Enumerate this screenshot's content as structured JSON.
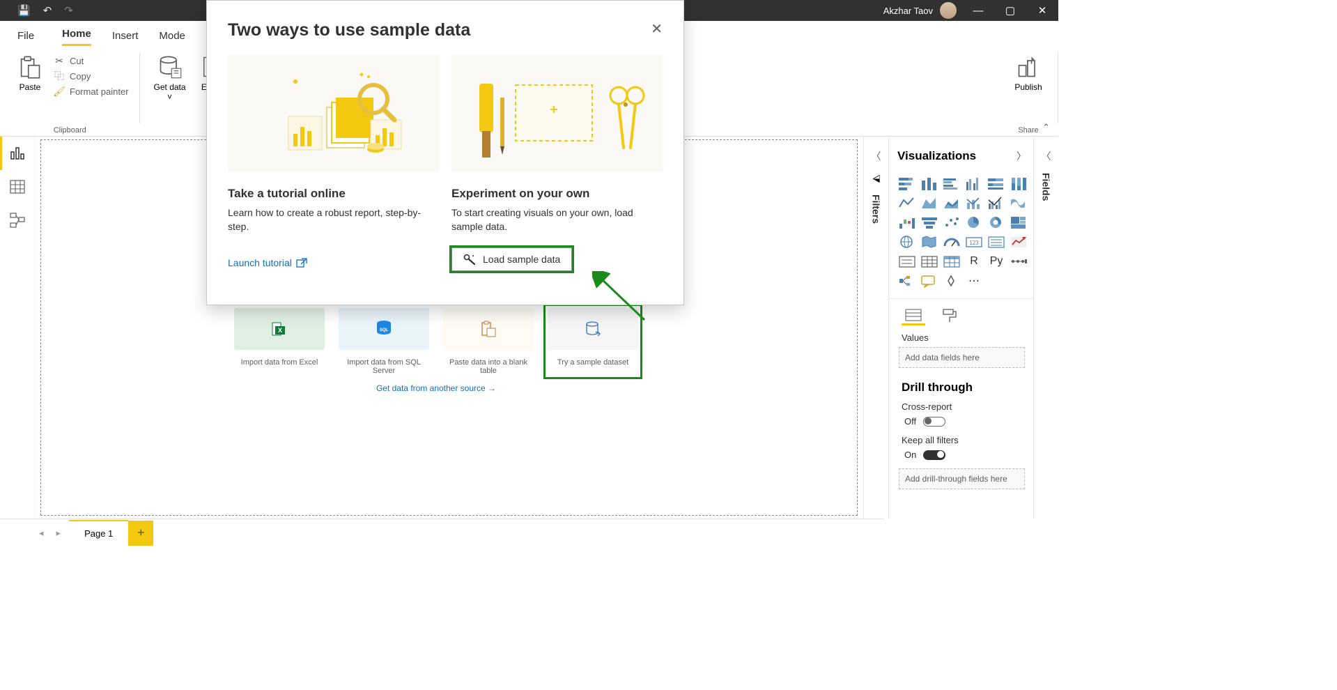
{
  "titlebar": {
    "user": "Akzhar Taov"
  },
  "tabs": {
    "file": "File",
    "home": "Home",
    "insert": "Insert",
    "modeling": "Mode"
  },
  "ribbon": {
    "clipboard_label": "Clipboard",
    "paste": "Paste",
    "cut": "Cut",
    "copy": "Copy",
    "format_painter": "Format painter",
    "data_label": "",
    "get_data": "Get data",
    "excel": "Excel",
    "share_label": "Share",
    "publish": "Publish"
  },
  "canvas_cards": {
    "excel": "Import data from Excel",
    "sql": "Import data from SQL Server",
    "paste": "Paste data into a blank table",
    "sample": "Try a sample dataset",
    "another_source": "Get data from another source →"
  },
  "filters_label": "Filters",
  "viz_panel": {
    "title": "Visualizations",
    "values_label": "Values",
    "values_placeholder": "Add data fields here",
    "drill_title": "Drill through",
    "cross_report": "Cross-report",
    "cross_report_state": "Off",
    "keep_filters": "Keep all filters",
    "keep_filters_state": "On",
    "drill_placeholder": "Add drill-through fields here"
  },
  "fields_label": "Fields",
  "page_tab": "Page 1",
  "modal": {
    "title": "Two ways to use sample data",
    "left_h": "Take a tutorial online",
    "left_p": "Learn how to create a robust report, step-by-step.",
    "left_link": "Launch tutorial",
    "right_h": "Experiment on your own",
    "right_p": "To start creating visuals on your own, load sample data.",
    "right_btn": "Load sample data"
  },
  "colors": {
    "accent": "#f2c811",
    "link": "#106ebe",
    "annotation": "#1a8a1a"
  }
}
